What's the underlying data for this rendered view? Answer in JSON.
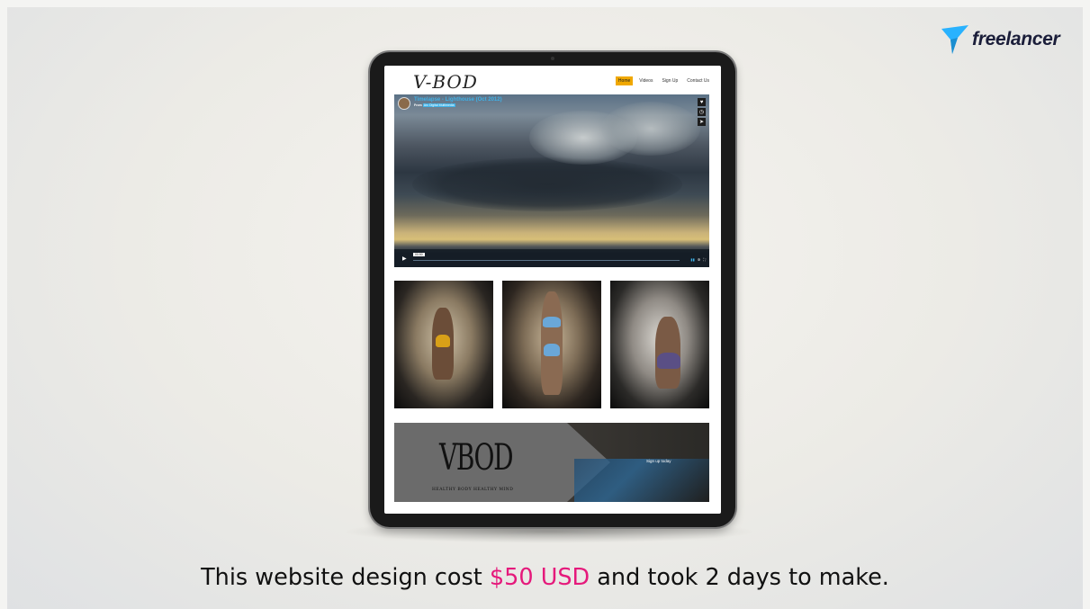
{
  "brand": {
    "logo_text": "freelancer",
    "icon": "freelancer-bird-icon",
    "colors": {
      "logo_blue": "#29b2fe",
      "logo_text": "#1b1e3a"
    }
  },
  "site": {
    "logo": "V-BOD",
    "nav": [
      "Home",
      "Videos",
      "Sign Up",
      "Contact Us"
    ],
    "active_nav": "Home",
    "accent": "#f0a800"
  },
  "video": {
    "title": "Timelapse - Lighthouse (Oct 2012)",
    "from_label": "From",
    "channel": "Arc Digital Multimedia",
    "time": "00:50",
    "side_icons": [
      "heart-icon",
      "clock-icon",
      "send-icon"
    ],
    "controls": [
      "play-icon",
      "volume-icon",
      "settings-icon",
      "fullscreen-icon"
    ]
  },
  "gallery": [
    "photo-1",
    "photo-2",
    "photo-3"
  ],
  "banner": {
    "logo": "VBOD",
    "tagline": "HEALTHY BODY HEALTHY MIND",
    "cta": "Sign up today"
  },
  "caption": {
    "prefix": "This website design cost ",
    "price": "$50 USD",
    "suffix": " and took 2 days to make.",
    "highlight_color": "#e5197b"
  }
}
